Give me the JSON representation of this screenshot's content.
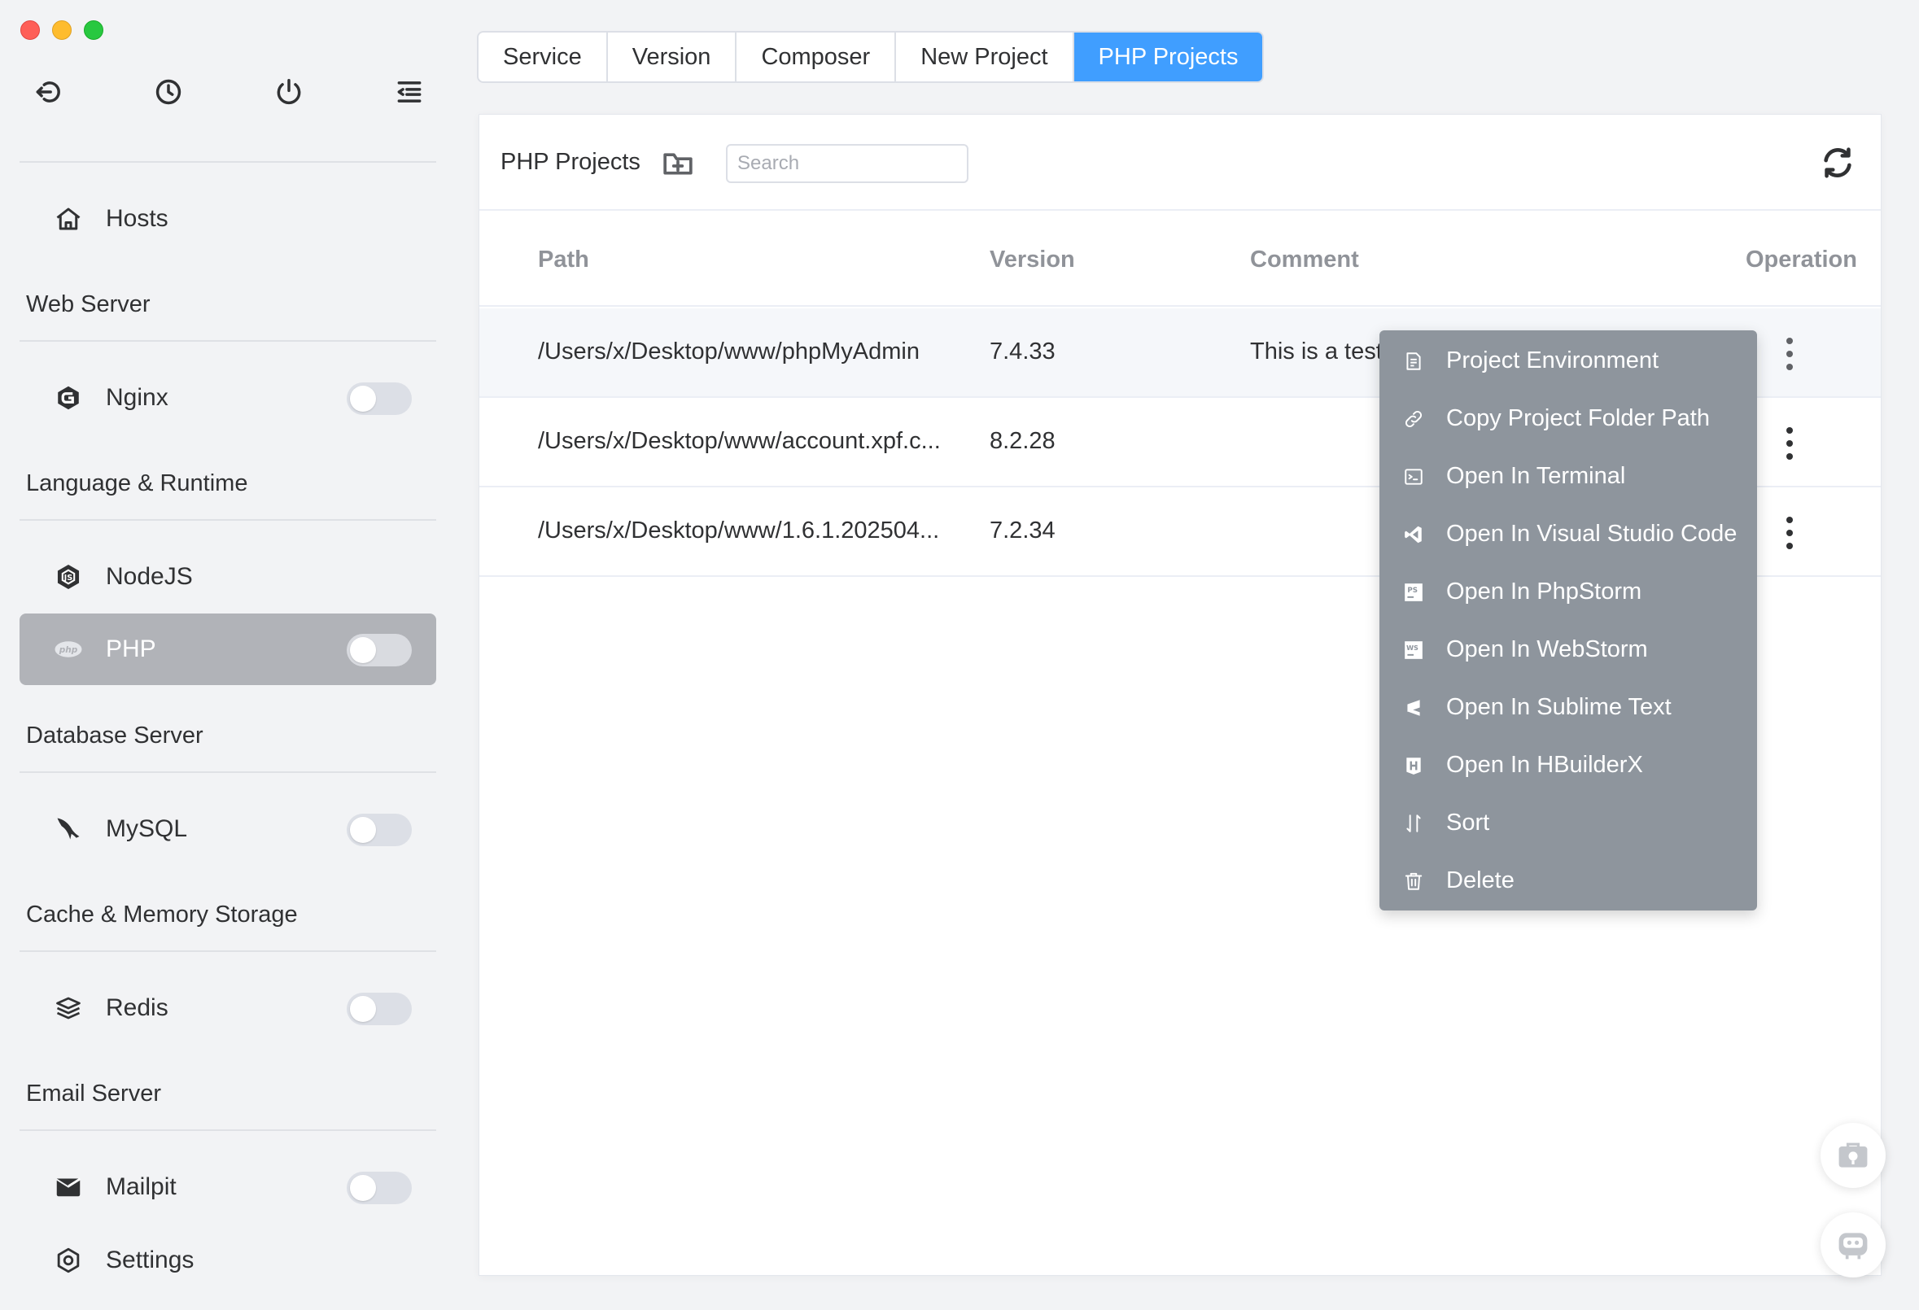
{
  "app": {
    "window_controls": [
      "close",
      "minimize",
      "zoom"
    ]
  },
  "sidebar": {
    "toolbar": [
      {
        "name": "logout-icon"
      },
      {
        "name": "history-icon"
      },
      {
        "name": "power-icon"
      },
      {
        "name": "menu-collapse-icon"
      }
    ],
    "sections": {
      "web_server": "Web Server",
      "language_runtime": "Language & Runtime",
      "database_server": "Database Server",
      "cache_storage": "Cache & Memory Storage",
      "email_server": "Email Server"
    },
    "items": {
      "hosts": {
        "label": "Hosts",
        "icon": "home-icon"
      },
      "nginx": {
        "label": "Nginx",
        "icon": "nginx-icon",
        "enabled": false
      },
      "nodejs": {
        "label": "NodeJS",
        "icon": "nodejs-icon"
      },
      "php": {
        "label": "PHP",
        "icon": "php-icon",
        "enabled": false,
        "active": true
      },
      "mysql": {
        "label": "MySQL",
        "icon": "mysql-icon",
        "enabled": false
      },
      "redis": {
        "label": "Redis",
        "icon": "redis-icon",
        "enabled": false
      },
      "mailpit": {
        "label": "Mailpit",
        "icon": "mailpit-icon",
        "enabled": false
      },
      "settings": {
        "label": "Settings",
        "icon": "gear-icon"
      }
    }
  },
  "tabs": [
    {
      "label": "Service",
      "active": false
    },
    {
      "label": "Version",
      "active": false
    },
    {
      "label": "Composer",
      "active": false
    },
    {
      "label": "New Project",
      "active": false
    },
    {
      "label": "PHP Projects",
      "active": true
    }
  ],
  "panel": {
    "title": "PHP Projects",
    "search_placeholder": "Search",
    "columns": {
      "path": "Path",
      "version": "Version",
      "comment": "Comment",
      "operation": "Operation"
    },
    "rows": [
      {
        "path": "/Users/x/Desktop/www/phpMyAdmin",
        "version": "7.4.33",
        "comment": "This is a test"
      },
      {
        "path": "/Users/x/Desktop/www/account.xpf.c...",
        "version": "8.2.28",
        "comment": ""
      },
      {
        "path": "/Users/x/Desktop/www/1.6.1.202504...",
        "version": "7.2.34",
        "comment": ""
      }
    ]
  },
  "context_menu": {
    "items": [
      {
        "label": "Project Environment",
        "icon": "environment-icon"
      },
      {
        "label": "Copy Project Folder Path",
        "icon": "link-icon"
      },
      {
        "label": "Open In Terminal",
        "icon": "terminal-icon"
      },
      {
        "label": "Open In Visual Studio Code",
        "icon": "vscode-icon"
      },
      {
        "label": "Open In PhpStorm",
        "icon": "phpstorm-icon"
      },
      {
        "label": "Open In WebStorm",
        "icon": "webstorm-icon"
      },
      {
        "label": "Open In Sublime Text",
        "icon": "sublime-icon"
      },
      {
        "label": "Open In HBuilderX",
        "icon": "hbuilderx-icon"
      },
      {
        "label": "Sort",
        "icon": "sort-icon"
      },
      {
        "label": "Delete",
        "icon": "trash-icon"
      }
    ]
  },
  "colors": {
    "accent": "#409eff",
    "menu_bg": "#8e959d",
    "active_nav_bg": "#b1b3b8"
  }
}
